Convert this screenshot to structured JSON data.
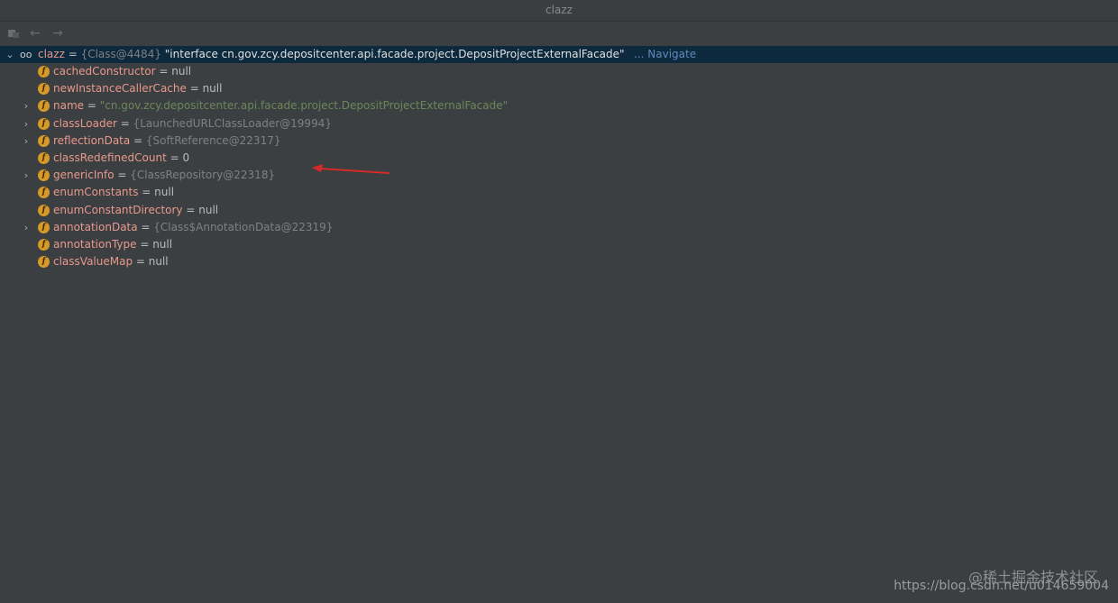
{
  "window": {
    "title": "clazz"
  },
  "toolbar": {
    "icons": [
      "frames-icon",
      "back-arrow-icon",
      "forward-arrow-icon"
    ]
  },
  "root": {
    "name": "clazz",
    "eq": " = ",
    "ref": "{Class@4484}",
    "value": " \"interface cn.gov.zcy.depositcenter.api.facade.project.DepositProjectExternalFacade\"",
    "navigate": "... Navigate"
  },
  "fields": [
    {
      "name": "cachedConstructor",
      "value": "null",
      "kind": "plain",
      "expandable": false
    },
    {
      "name": "newInstanceCallerCache",
      "value": "null",
      "kind": "plain",
      "expandable": false
    },
    {
      "name": "name",
      "value": "\"cn.gov.zcy.depositcenter.api.facade.project.DepositProjectExternalFacade\"",
      "kind": "str",
      "expandable": true
    },
    {
      "name": "classLoader",
      "value": "{LaunchedURLClassLoader@19994}",
      "kind": "ref",
      "expandable": true
    },
    {
      "name": "reflectionData",
      "value": "{SoftReference@22317}",
      "kind": "ref",
      "expandable": true
    },
    {
      "name": "classRedefinedCount",
      "value": "0",
      "kind": "plain",
      "expandable": false
    },
    {
      "name": "genericInfo",
      "value": "{ClassRepository@22318}",
      "kind": "ref",
      "expandable": true
    },
    {
      "name": "enumConstants",
      "value": "null",
      "kind": "plain",
      "expandable": false
    },
    {
      "name": "enumConstantDirectory",
      "value": "null",
      "kind": "plain",
      "expandable": false
    },
    {
      "name": "annotationData",
      "value": "{Class$AnnotationData@22319}",
      "kind": "ref",
      "expandable": true
    },
    {
      "name": "annotationType",
      "value": "null",
      "kind": "plain",
      "expandable": false
    },
    {
      "name": "classValueMap",
      "value": "null",
      "kind": "plain",
      "expandable": false
    }
  ],
  "eq_sign": " = ",
  "field_icon_letter": "f",
  "watermark": {
    "line1": "@稀土掘金技术社区",
    "line2": "https://blog.csdn.net/u014659004"
  },
  "colors": {
    "selection": "#0d293e",
    "field_name": "#e8998d",
    "string": "#6a8759",
    "ref": "#808080",
    "field_icon": "#d59a2a",
    "annotation_arrow": "#d62a2a"
  }
}
